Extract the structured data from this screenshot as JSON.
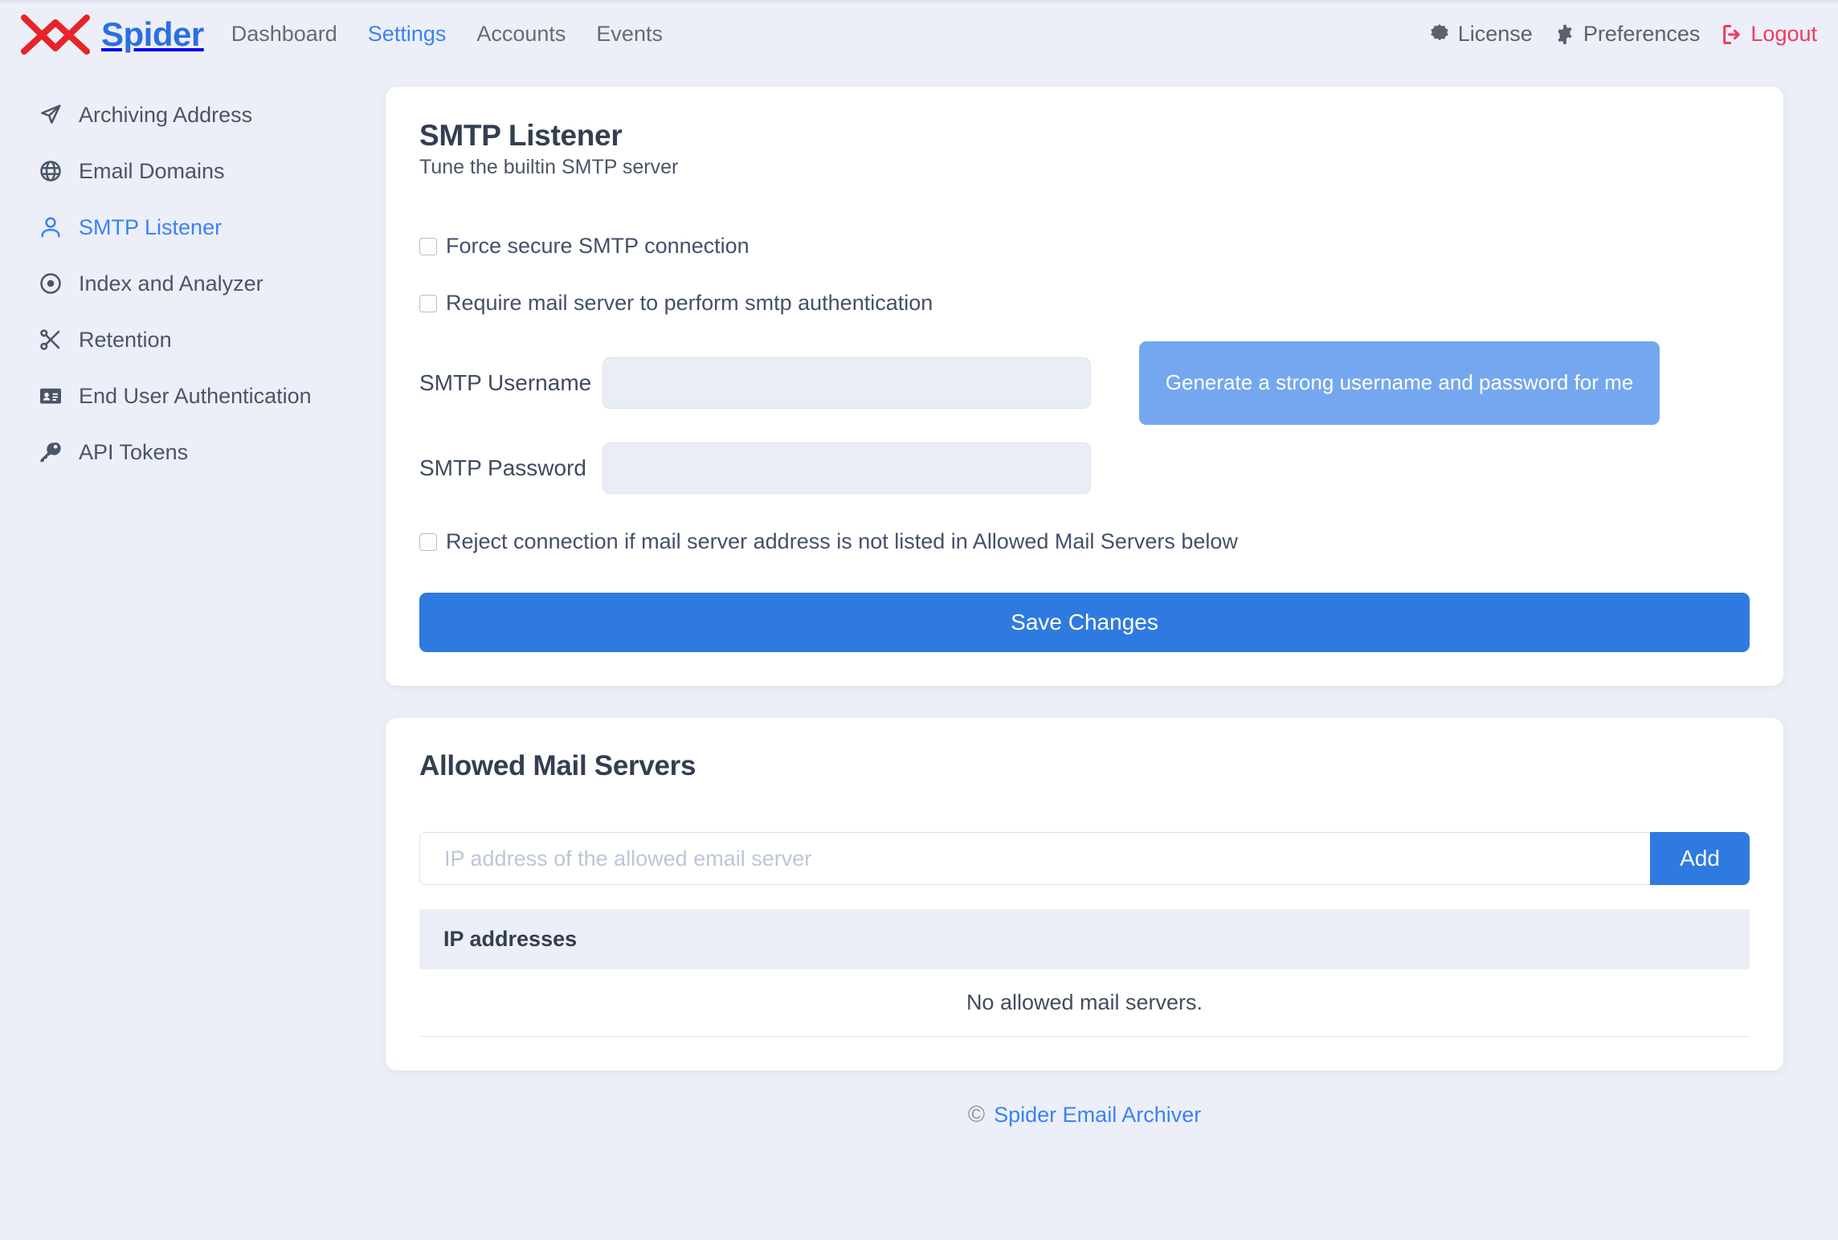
{
  "colors": {
    "accent": "#3b82f6",
    "accent_strong": "#2f7ae0",
    "accent_soft": "#74a7ef",
    "danger": "#f03a5f",
    "page_bg": "#eceff7",
    "brand": "#2b6fe0",
    "logo_red": "#e8232a",
    "text": "#3c4858",
    "muted": "#6b6b6b"
  },
  "header": {
    "brand_name": "Spider",
    "logo_icon": "envelope-x-logo",
    "nav": [
      {
        "label": "Dashboard",
        "active": false
      },
      {
        "label": "Settings",
        "active": true
      },
      {
        "label": "Accounts",
        "active": false
      },
      {
        "label": "Events",
        "active": false
      }
    ],
    "right": [
      {
        "label": "License",
        "icon": "certificate-icon",
        "danger": false
      },
      {
        "label": "Preferences",
        "icon": "gear-icon",
        "danger": false
      },
      {
        "label": "Logout",
        "icon": "logout-icon",
        "danger": true
      }
    ]
  },
  "sidebar": {
    "items": [
      {
        "label": "Archiving Address",
        "icon": "paper-plane-icon",
        "active": false
      },
      {
        "label": "Email Domains",
        "icon": "globe-icon",
        "active": false
      },
      {
        "label": "SMTP Listener",
        "icon": "user-icon",
        "active": true
      },
      {
        "label": "Index and Analyzer",
        "icon": "target-icon",
        "active": false
      },
      {
        "label": "Retention",
        "icon": "scissors-icon",
        "active": false
      },
      {
        "label": "End User Authentication",
        "icon": "id-card-icon",
        "active": false
      },
      {
        "label": "API Tokens",
        "icon": "key-icon",
        "active": false
      }
    ]
  },
  "smtp_listener": {
    "title": "SMTP Listener",
    "subtitle": "Tune the builtin SMTP server",
    "checkboxes": [
      {
        "label": "Force secure SMTP connection",
        "checked": false
      },
      {
        "label": "Require mail server to perform smtp authentication",
        "checked": false
      }
    ],
    "username_label": "SMTP Username",
    "username_value": "",
    "username_placeholder": "",
    "password_label": "SMTP Password",
    "password_value": "",
    "password_placeholder": "",
    "generate_label": "Generate a strong username and password for me",
    "reject_label": "Reject connection if mail server address is not listed in Allowed Mail Servers below",
    "reject_checked": false,
    "save_label": "Save Changes"
  },
  "allowed_mail_servers": {
    "title": "Allowed Mail Servers",
    "ip_input_value": "",
    "ip_input_placeholder": "IP address of the allowed email server",
    "add_label": "Add",
    "table_header": "IP addresses",
    "rows": [],
    "empty_text": "No allowed mail servers."
  },
  "footer": {
    "copyright_symbol": "©",
    "text": "Spider Email Archiver"
  }
}
